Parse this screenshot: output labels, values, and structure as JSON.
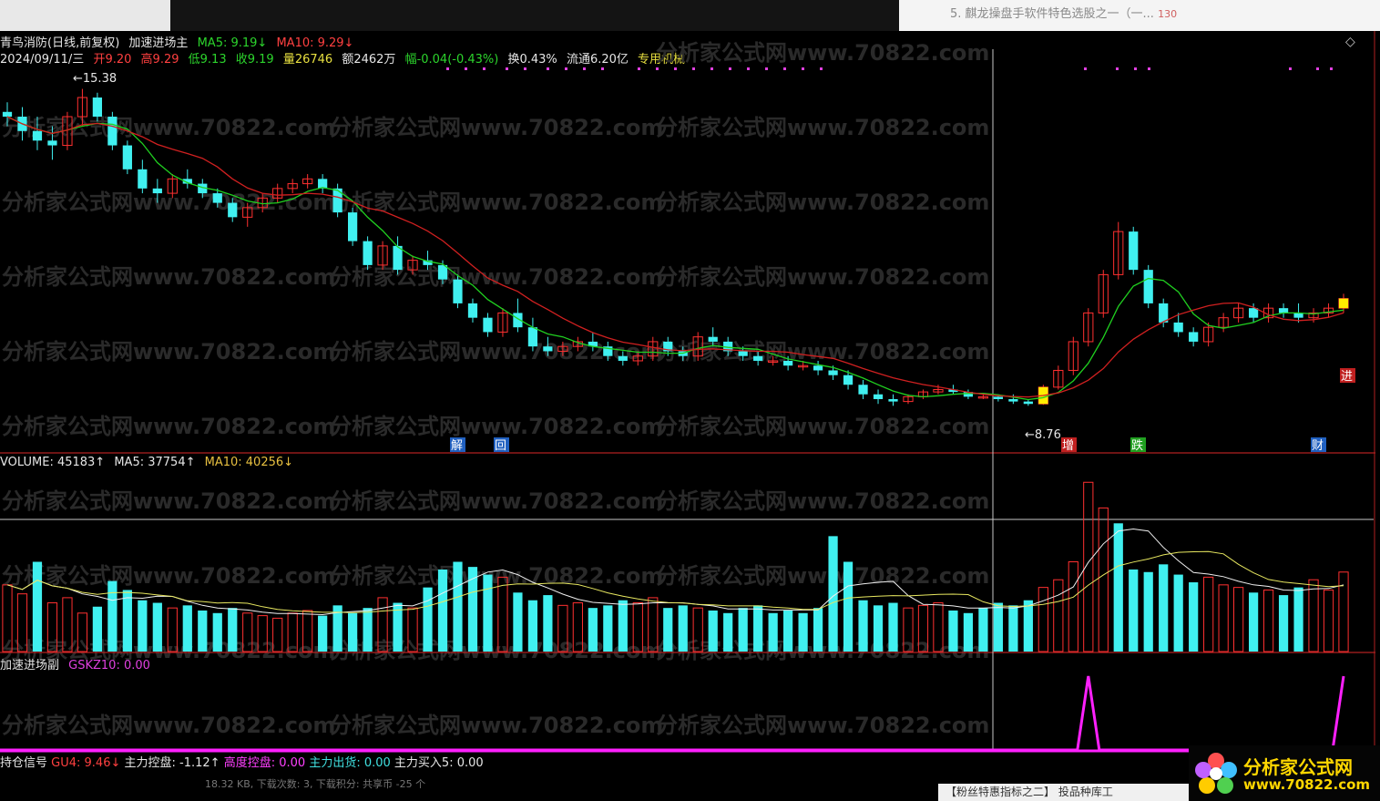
{
  "topbar": {
    "news": "5. 麒龙操盘手软件特色选股之一（一...",
    "news_badge": "130"
  },
  "main_header": {
    "name": "青鸟消防(日线,前复权)",
    "indicator": "加速进场主",
    "ma5": "MA5: 9.19↓",
    "ma10": "MA10: 9.29↓",
    "date": "2024/09/11/三",
    "open": "开9.20",
    "high": "高9.29",
    "low": "低9.13",
    "close": "收9.19",
    "vol": "量26746",
    "amount": "额2462万",
    "change": "幅-0.04(-0.43%)",
    "turnover": "换0.43%",
    "float": "流通6.20亿",
    "sector": "专用机械"
  },
  "watermark": "分析家公式网www.70822.com",
  "volume_header": {
    "volume": "VOLUME: 45183↑",
    "ma5": "MA5: 37754↑",
    "ma10": "MA10: 40256↓"
  },
  "sub_header": {
    "name": "加速进场副",
    "value": "GSKZ10: 0.00"
  },
  "footer": {
    "name": "持仓信号",
    "gu4": "GU4: 9.46↓",
    "kp": "主力控盘: -1.12↑",
    "gd": "高度控盘: 0.00",
    "ch": "主力出货: 0.00",
    "buy": "主力买入5: 0.00",
    "fileinfo": "18.32 KB, 下载次数: 3, 下载积分: 共享币 -25 个",
    "bottom_tab": "【粉丝特惠指标之二】    投品种库工"
  },
  "logo": {
    "title": "分析家公式网",
    "url": "www.70822.com"
  },
  "chart_data": {
    "type": "candlestick",
    "colors": {
      "up": "#ff3030",
      "down": "#40f0f0",
      "ma5": "#20d020",
      "ma10": "#d02020",
      "volma5": "#f0f0f0",
      "volma10": "#e8e860",
      "signal": "#ff20ff"
    },
    "price_labels": {
      "high_mark": "15.38",
      "low_mark": "8.76"
    },
    "markers": [
      "解",
      "回",
      "增",
      "跌",
      "财",
      "进"
    ],
    "ylim": [
      8.5,
      15.6
    ],
    "candles": [
      [
        14.9,
        15.1,
        14.6,
        14.8
      ],
      [
        14.8,
        15.0,
        14.3,
        14.5
      ],
      [
        14.5,
        14.8,
        14.1,
        14.3
      ],
      [
        14.3,
        14.6,
        13.9,
        14.2
      ],
      [
        14.2,
        14.9,
        14.1,
        14.8
      ],
      [
        14.8,
        15.38,
        14.6,
        15.2
      ],
      [
        15.2,
        15.3,
        14.7,
        14.8
      ],
      [
        14.8,
        14.9,
        14.1,
        14.2
      ],
      [
        14.2,
        14.3,
        13.6,
        13.7
      ],
      [
        13.7,
        13.9,
        13.2,
        13.3
      ],
      [
        13.3,
        13.5,
        13.0,
        13.2
      ],
      [
        13.2,
        13.6,
        13.1,
        13.5
      ],
      [
        13.5,
        13.7,
        13.3,
        13.4
      ],
      [
        13.4,
        13.5,
        13.1,
        13.2
      ],
      [
        13.2,
        13.3,
        12.9,
        13.0
      ],
      [
        13.0,
        13.1,
        12.6,
        12.7
      ],
      [
        12.7,
        13.0,
        12.5,
        12.9
      ],
      [
        12.9,
        13.2,
        12.8,
        13.1
      ],
      [
        13.1,
        13.4,
        13.0,
        13.3
      ],
      [
        13.3,
        13.5,
        13.2,
        13.4
      ],
      [
        13.4,
        13.6,
        13.3,
        13.5
      ],
      [
        13.5,
        13.6,
        13.2,
        13.3
      ],
      [
        13.3,
        13.4,
        12.7,
        12.8
      ],
      [
        12.8,
        12.9,
        12.1,
        12.2
      ],
      [
        12.2,
        12.3,
        11.6,
        11.7
      ],
      [
        11.7,
        12.2,
        11.6,
        12.1
      ],
      [
        12.1,
        12.3,
        11.5,
        11.6
      ],
      [
        11.6,
        11.9,
        11.5,
        11.8
      ],
      [
        11.8,
        12.0,
        11.6,
        11.7
      ],
      [
        11.7,
        11.8,
        11.3,
        11.4
      ],
      [
        11.4,
        11.5,
        10.8,
        10.9
      ],
      [
        10.9,
        11.0,
        10.5,
        10.6
      ],
      [
        10.6,
        10.7,
        10.2,
        10.3
      ],
      [
        10.3,
        10.8,
        10.2,
        10.7
      ],
      [
        10.7,
        11.0,
        10.3,
        10.4
      ],
      [
        10.4,
        10.6,
        9.9,
        10.0
      ],
      [
        10.0,
        10.2,
        9.8,
        9.9
      ],
      [
        9.9,
        10.1,
        9.8,
        10.0
      ],
      [
        10.0,
        10.2,
        9.9,
        10.1
      ],
      [
        10.1,
        10.3,
        9.9,
        10.0
      ],
      [
        10.0,
        10.1,
        9.7,
        9.8
      ],
      [
        9.8,
        9.9,
        9.6,
        9.7
      ],
      [
        9.7,
        9.9,
        9.6,
        9.8
      ],
      [
        9.8,
        10.2,
        9.7,
        10.1
      ],
      [
        10.1,
        10.2,
        9.8,
        9.9
      ],
      [
        9.9,
        10.0,
        9.7,
        9.8
      ],
      [
        9.8,
        10.3,
        9.7,
        10.2
      ],
      [
        10.2,
        10.4,
        10.0,
        10.1
      ],
      [
        10.1,
        10.2,
        9.8,
        9.9
      ],
      [
        9.9,
        10.0,
        9.7,
        9.8
      ],
      [
        9.8,
        9.9,
        9.6,
        9.7
      ],
      [
        9.7,
        9.8,
        9.6,
        9.7
      ],
      [
        9.7,
        9.8,
        9.5,
        9.6
      ],
      [
        9.6,
        9.7,
        9.5,
        9.6
      ],
      [
        9.6,
        9.7,
        9.4,
        9.5
      ],
      [
        9.5,
        9.6,
        9.3,
        9.4
      ],
      [
        9.4,
        9.5,
        9.1,
        9.2
      ],
      [
        9.2,
        9.3,
        8.9,
        9.0
      ],
      [
        9.0,
        9.1,
        8.8,
        8.9
      ],
      [
        8.9,
        9.0,
        8.76,
        8.85
      ],
      [
        8.85,
        9.0,
        8.8,
        8.95
      ],
      [
        8.95,
        9.1,
        8.9,
        9.05
      ],
      [
        9.05,
        9.2,
        9.0,
        9.1
      ],
      [
        9.1,
        9.2,
        9.0,
        9.05
      ],
      [
        9.05,
        9.1,
        8.9,
        8.95
      ],
      [
        8.95,
        9.0,
        8.9,
        8.95
      ],
      [
        8.95,
        9.0,
        8.85,
        8.9
      ],
      [
        8.9,
        9.0,
        8.8,
        8.85
      ],
      [
        8.85,
        8.9,
        8.76,
        8.8
      ],
      [
        8.8,
        9.2,
        8.78,
        9.15
      ],
      [
        9.15,
        9.6,
        9.1,
        9.5
      ],
      [
        9.5,
        10.2,
        9.4,
        10.1
      ],
      [
        10.1,
        10.8,
        10.0,
        10.7
      ],
      [
        10.7,
        11.6,
        10.6,
        11.5
      ],
      [
        11.5,
        12.6,
        11.4,
        12.4
      ],
      [
        12.4,
        12.5,
        11.5,
        11.6
      ],
      [
        11.6,
        11.7,
        10.8,
        10.9
      ],
      [
        10.9,
        11.0,
        10.4,
        10.5
      ],
      [
        10.5,
        10.7,
        10.2,
        10.3
      ],
      [
        10.3,
        10.4,
        10.0,
        10.1
      ],
      [
        10.1,
        10.5,
        10.0,
        10.4
      ],
      [
        10.4,
        10.7,
        10.3,
        10.6
      ],
      [
        10.6,
        10.9,
        10.5,
        10.8
      ],
      [
        10.8,
        10.9,
        10.5,
        10.6
      ],
      [
        10.6,
        10.9,
        10.5,
        10.8
      ],
      [
        10.8,
        10.9,
        10.6,
        10.7
      ],
      [
        10.7,
        10.9,
        10.5,
        10.6
      ],
      [
        10.6,
        10.8,
        10.5,
        10.7
      ],
      [
        10.7,
        10.9,
        10.6,
        10.8
      ],
      [
        10.8,
        11.1,
        10.7,
        11.0
      ]
    ],
    "volumes": [
      52,
      45,
      70,
      38,
      42,
      30,
      35,
      55,
      48,
      40,
      38,
      34,
      36,
      32,
      30,
      34,
      30,
      28,
      26,
      30,
      32,
      28,
      36,
      30,
      34,
      42,
      38,
      34,
      50,
      64,
      70,
      66,
      60,
      58,
      46,
      40,
      44,
      36,
      38,
      34,
      36,
      40,
      38,
      42,
      34,
      36,
      34,
      32,
      30,
      34,
      36,
      30,
      32,
      30,
      34,
      90,
      70,
      40,
      36,
      38,
      34,
      36,
      38,
      32,
      30,
      34,
      38,
      36,
      40,
      50,
      56,
      70,
      132,
      112,
      100,
      64,
      62,
      68,
      60,
      54,
      58,
      52,
      50,
      46,
      48,
      44,
      50,
      56,
      48,
      62
    ],
    "volume_up": [
      true,
      true,
      false,
      true,
      true,
      true,
      false,
      false,
      false,
      false,
      false,
      true,
      false,
      false,
      false,
      false,
      true,
      true,
      true,
      true,
      true,
      false,
      false,
      false,
      false,
      true,
      false,
      true,
      false,
      false,
      false,
      false,
      false,
      true,
      false,
      false,
      false,
      true,
      true,
      false,
      false,
      false,
      true,
      true,
      false,
      false,
      true,
      false,
      false,
      false,
      false,
      false,
      false,
      false,
      false,
      false,
      false,
      false,
      false,
      false,
      true,
      true,
      true,
      false,
      false,
      false,
      false,
      false,
      false,
      true,
      true,
      true,
      true,
      true,
      false,
      false,
      false,
      false,
      false,
      false,
      true,
      true,
      true,
      false,
      true,
      false,
      false,
      true,
      true,
      true
    ],
    "signal_peaks": [
      72,
      89
    ]
  }
}
